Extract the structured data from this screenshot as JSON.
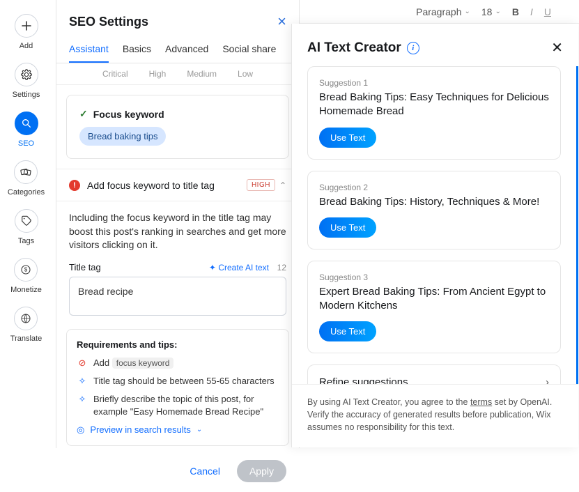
{
  "rail": {
    "items": [
      {
        "label": "Add",
        "icon": "plus"
      },
      {
        "label": "Settings",
        "icon": "gear"
      },
      {
        "label": "SEO",
        "icon": "search",
        "active": true
      },
      {
        "label": "Categories",
        "icon": "cards"
      },
      {
        "label": "Tags",
        "icon": "tag"
      },
      {
        "label": "Monetize",
        "icon": "dollar"
      },
      {
        "label": "Translate",
        "icon": "globe"
      }
    ]
  },
  "seo": {
    "title": "SEO Settings",
    "tabs": [
      "Assistant",
      "Basics",
      "Advanced",
      "Social share"
    ],
    "active_tab": 0,
    "filters": [
      "Critical",
      "High",
      "Medium",
      "Low"
    ],
    "focus": {
      "label": "Focus keyword",
      "chip": "Bread baking tips"
    },
    "warning": {
      "text": "Add focus keyword to title tag",
      "badge": "HIGH"
    },
    "desc": "Including the focus keyword in the title tag may boost this post's ranking in searches and get more visitors clicking on it.",
    "titletag": {
      "label": "Title tag",
      "ai_link": "Create AI text",
      "count": "12",
      "value": "Bread recipe"
    },
    "req": {
      "heading": "Requirements and tips:",
      "add_prefix": "Add",
      "add_kw": "focus keyword",
      "tip1": "Title tag should be between 55-65 characters",
      "tip2": "Briefly describe the topic of this post, for example \"Easy Homemade Bread Recipe\"",
      "preview": "Preview in search results"
    },
    "actions": {
      "cancel": "Cancel",
      "apply": "Apply"
    }
  },
  "toolbar": {
    "style": "Paragraph",
    "size": "18"
  },
  "ai": {
    "title": "AI Text Creator",
    "suggestions": [
      {
        "label": "Suggestion 1",
        "text": "Bread Baking Tips: Easy Techniques for Delicious Homemade Bread",
        "btn": "Use Text"
      },
      {
        "label": "Suggestion 2",
        "text": "Bread Baking Tips: History, Techniques & More!",
        "btn": "Use Text"
      },
      {
        "label": "Suggestion 3",
        "text": "Expert Bread Baking Tips: From Ancient Egypt to Modern Kitchens",
        "btn": "Use Text"
      }
    ],
    "refine": "Refine suggestions",
    "footer_pre": "By using AI Text Creator, you agree to the ",
    "footer_terms": "terms",
    "footer_post": " set by OpenAI. Verify the accuracy of generated results before publication, Wix assumes no responsibility for this text."
  }
}
